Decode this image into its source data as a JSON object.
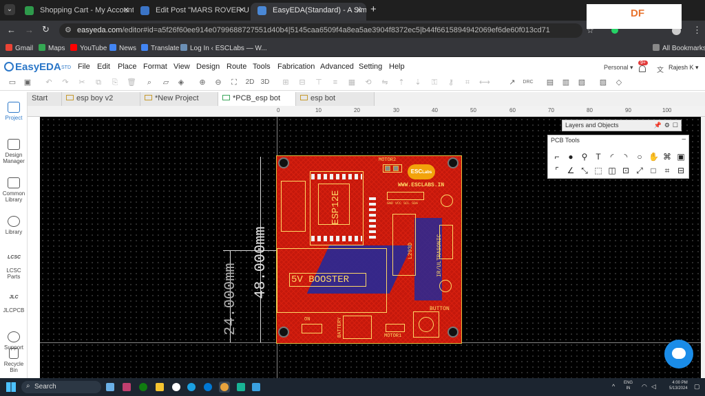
{
  "browser": {
    "tabs": [
      {
        "title": "Shopping Cart - My Account - PC",
        "color": "#2e9a4b"
      },
      {
        "title": "Edit Post \"MARS ROVER USING N",
        "color": "#3b74c6"
      },
      {
        "title": "EasyEDA(Standard) - A Simple and",
        "color": "#4a88d6",
        "active": true
      }
    ],
    "url_host": "easyeda.com",
    "url_path": "/editor#id=a5f26f60ee914e0799688727551d40b4|5145caa6509f4a8ea5ae3904f8372ec5|b44f6615894942069ef6de60f013cd71",
    "bookmarks": [
      "Gmail",
      "Maps",
      "YouTube",
      "News",
      "Translate",
      "Log In ‹ ESCLabs — W..."
    ],
    "all_bookmarks": "All Bookmarks",
    "watermark": "DF"
  },
  "editor": {
    "logo": "EasyEDA",
    "logo_suffix": "STD",
    "menu": [
      "File",
      "Edit",
      "Place",
      "Format",
      "View",
      "Design",
      "Route",
      "Tools",
      "Fabrication",
      "Advanced",
      "Setting",
      "Help"
    ],
    "account_mode": "Personal ▾",
    "notifications": "9+",
    "user": "Rajesh K ▾",
    "doc_tabs": [
      "Start",
      "esp boy v2",
      "*New Project",
      "*PCB_esp bot",
      "esp bot"
    ],
    "active_doc_tab": "*PCB_esp bot",
    "toolbar_labels": {
      "two_d": "2D",
      "three_d": "3D",
      "drc": "DRC"
    },
    "left_panel": [
      {
        "label": "Project"
      },
      {
        "label": "Design Manager"
      },
      {
        "label": "Common Library"
      },
      {
        "label": "Library"
      },
      {
        "label": "LCSC Parts"
      },
      {
        "label": "JLCPCB"
      },
      {
        "label": "Support"
      },
      {
        "label": "Recycle Bin"
      }
    ],
    "ruler_ticks": [
      "0",
      "10",
      "20",
      "30",
      "40",
      "50",
      "60",
      "70",
      "80",
      "90",
      "100"
    ],
    "layers_panel": "Layers and Objects",
    "pcb_tools_title": "PCB Tools"
  },
  "pcb": {
    "dimension_v1": "48.000mm",
    "dimension_v2": "24.000mm",
    "silkscreen": {
      "motor2": "MOTOR2",
      "brand": "ESC",
      "brand_sub": "Labs",
      "website": "WWW.ESCLABS.IN",
      "module": "ESP12E",
      "pin_labels": "GND VCC SCL SDA",
      "driver": "L293D",
      "sensor": "IR/ULTRASONIC",
      "booster": "5V BOOSTER",
      "on": "ON",
      "battery": "BATTERY",
      "motor1": "MOTOR1",
      "button": "BUTTON"
    }
  },
  "taskbar": {
    "search": "Search",
    "lang": "ENG",
    "region": "IN",
    "time": "4:00 PM",
    "date": "5/13/2024"
  }
}
